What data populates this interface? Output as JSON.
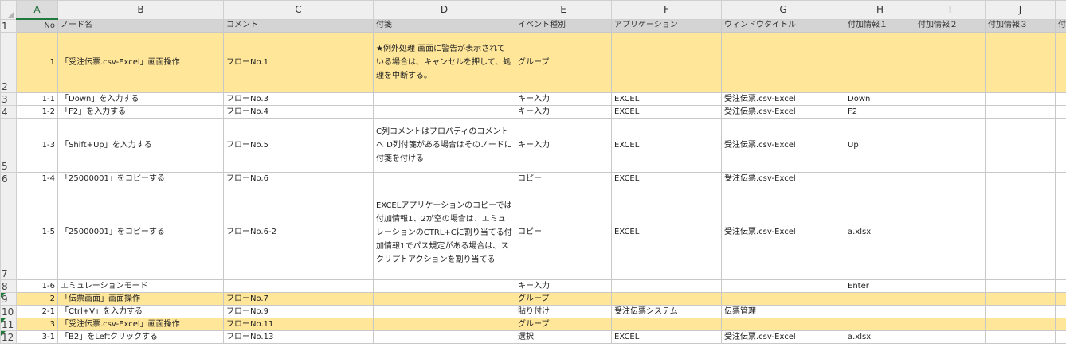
{
  "columns": [
    "A",
    "B",
    "C",
    "D",
    "E",
    "F",
    "G",
    "H",
    "I",
    "J"
  ],
  "selected_column": "A",
  "header_row": {
    "row_num": "1",
    "cells": [
      "No",
      "ノード名",
      "コメント",
      "付箋",
      "イベント種別",
      "アプリケーション",
      "ウィンドウタイトル",
      "付加情報１",
      "付加情報２",
      "付加情報３",
      "付"
    ]
  },
  "rows": [
    {
      "row_num": "2",
      "type": "group",
      "no": "1",
      "name": "「受注伝票.csv-Excel」画面操作",
      "comment": "フローNo.1",
      "memo": "★例外処理\n画面に警告が表示されている場合は、キャンセルを押して、処理を中断する。",
      "event": "グループ",
      "app": "",
      "window": "",
      "info1": "",
      "info2": "",
      "info3": ""
    },
    {
      "row_num": "3",
      "type": "normal",
      "no": "1-1",
      "name": "「Down」を入力する",
      "comment": "フローNo.3",
      "memo": "",
      "event": "キー入力",
      "app": "EXCEL",
      "window": "受注伝票.csv-Excel",
      "info1": "Down",
      "info2": "",
      "info3": ""
    },
    {
      "row_num": "4",
      "type": "normal",
      "no": "1-2",
      "name": "「F2」を入力する",
      "comment": "フローNo.4",
      "memo": "",
      "event": "キー入力",
      "app": "EXCEL",
      "window": "受注伝票.csv-Excel",
      "info1": "F2",
      "info2": "",
      "info3": ""
    },
    {
      "row_num": "5",
      "type": "normal",
      "no": "1-3",
      "name": "「Shift+Up」を入力する",
      "comment": "フローNo.5",
      "memo": "C列コメントはプロパティのコメントへ\nD列付箋がある場合はそのノードに付箋を付ける",
      "event": "キー入力",
      "app": "EXCEL",
      "window": "受注伝票.csv-Excel",
      "info1": "Up",
      "info2": "",
      "info3": ""
    },
    {
      "row_num": "6",
      "type": "normal",
      "no": "1-4",
      "name": "「25000001」をコピーする",
      "comment": "フローNo.6",
      "memo": "",
      "event": "コピー",
      "app": "EXCEL",
      "window": "受注伝票.csv-Excel",
      "info1": "",
      "info2": "",
      "info3": ""
    },
    {
      "row_num": "7",
      "type": "normal",
      "no": "1-5",
      "name": "「25000001」をコピーする",
      "comment": "フローNo.6-2",
      "memo": "EXCELアプリケーションのコピーでは\n付加情報1、2が空の場合は、エミュレーションのCTRL+Cに割り当てる付加情報1でパス規定がある場合は、スクリプトアクションを割り当てる",
      "event": "コピー",
      "app": "EXCEL",
      "window": "受注伝票.csv-Excel",
      "info1": "a.xlsx",
      "info2": "",
      "info3": ""
    },
    {
      "row_num": "8",
      "type": "normal",
      "no": "1-6",
      "name": "エミュレーションモード",
      "comment": "",
      "memo": "",
      "event": "キー入力",
      "app": "",
      "window": "",
      "info1": "Enter",
      "info2": "",
      "info3": ""
    },
    {
      "row_num": "9",
      "type": "group",
      "no": "2",
      "name": "「伝票画面」画面操作",
      "comment": "フローNo.7",
      "memo": "",
      "event": "グループ",
      "app": "",
      "window": "",
      "info1": "",
      "info2": "",
      "info3": ""
    },
    {
      "row_num": "10",
      "type": "normal",
      "no": "2-1",
      "name": "「Ctrl+V」を入力する",
      "comment": "フローNo.9",
      "memo": "",
      "event": "貼り付け",
      "app": "受注伝票システム",
      "window": "伝票管理",
      "info1": "",
      "info2": "",
      "info3": ""
    },
    {
      "row_num": "11",
      "type": "group",
      "no": "3",
      "name": "「受注伝票.csv-Excel」画面操作",
      "comment": "フローNo.11",
      "memo": "",
      "event": "グループ",
      "app": "",
      "window": "",
      "info1": "",
      "info2": "",
      "info3": ""
    },
    {
      "row_num": "12",
      "type": "normal",
      "no": "3-1",
      "name": "「B2」をLeftクリックする",
      "comment": "フローNo.13",
      "memo": "",
      "event": "選択",
      "app": "EXCEL",
      "window": "受注伝票.csv-Excel",
      "info1": "a.xlsx",
      "info2": "",
      "info3": ""
    }
  ],
  "colors": {
    "group_fill": "#ffe699",
    "header_fill": "#d4d4d4",
    "comment_marker": "#1a7a34"
  }
}
